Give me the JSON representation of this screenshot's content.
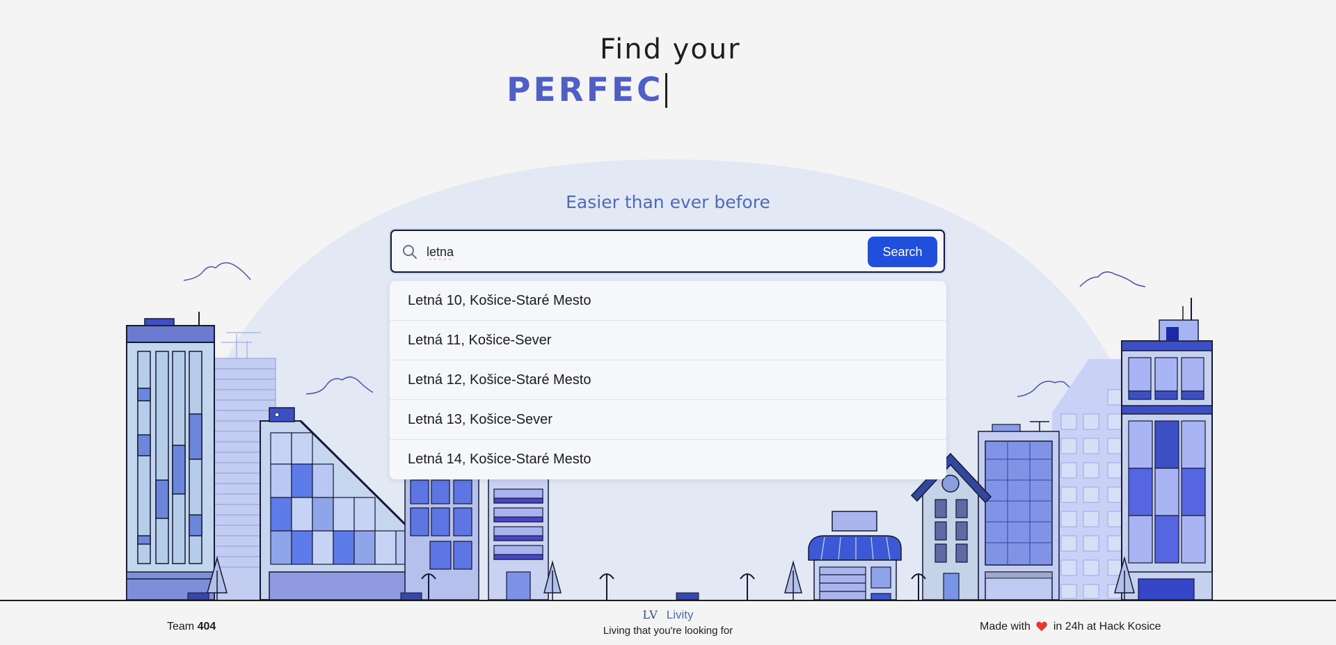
{
  "hero": {
    "title": "Find your",
    "typed_text": "PERFEC"
  },
  "search": {
    "tagline": "Easier than ever before",
    "value": "letna",
    "button_label": "Search",
    "suggestions": [
      "Letná 10, Košice-Staré Mesto",
      "Letná 11, Košice-Sever",
      "Letná 12, Košice-Staré Mesto",
      "Letná 13, Košice-Sever",
      "Letná 14, Košice-Staré Mesto"
    ]
  },
  "footer": {
    "team_prefix": "Team",
    "team_number": "404",
    "brand_logo": "LV",
    "brand_name": "Livity",
    "brand_tagline": "Living that you're looking for",
    "made_prefix": "Made with",
    "made_suffix": "in 24h at Hack Kosice"
  },
  "icons": {
    "search": "search-icon",
    "heart": "heart-icon"
  },
  "colors": {
    "accent": "#4f5fc4",
    "button": "#1f4fdc",
    "heart": "#e53935",
    "dome": "#e2e8f4"
  }
}
